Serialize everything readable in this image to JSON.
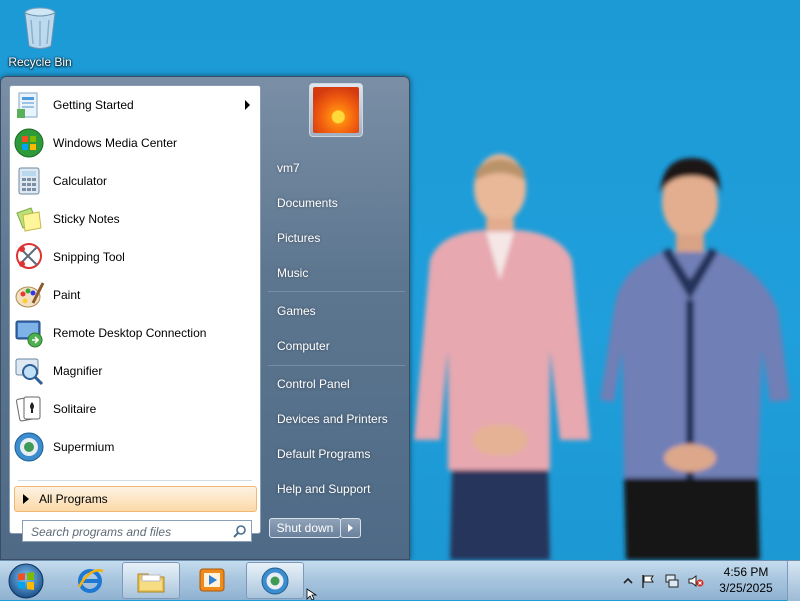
{
  "desktop": {
    "icons": [
      {
        "label": "Recycle Bin",
        "icon": "recycle-bin-icon"
      }
    ]
  },
  "start_menu": {
    "programs": [
      {
        "label": "Getting Started",
        "icon": "getting-started-icon",
        "has_submenu": true
      },
      {
        "label": "Windows Media Center",
        "icon": "media-center-icon"
      },
      {
        "label": "Calculator",
        "icon": "calculator-icon"
      },
      {
        "label": "Sticky Notes",
        "icon": "sticky-notes-icon"
      },
      {
        "label": "Snipping Tool",
        "icon": "snipping-tool-icon"
      },
      {
        "label": "Paint",
        "icon": "paint-icon"
      },
      {
        "label": "Remote Desktop Connection",
        "icon": "remote-desktop-icon"
      },
      {
        "label": "Magnifier",
        "icon": "magnifier-icon"
      },
      {
        "label": "Solitaire",
        "icon": "solitaire-icon"
      },
      {
        "label": "Supermium",
        "icon": "supermium-icon"
      }
    ],
    "all_programs": "All Programs",
    "search": {
      "placeholder": "Search programs and files"
    },
    "user": {
      "picture": "flower-user-picture"
    },
    "right_items": [
      {
        "label": "vm7"
      },
      {
        "label": "Documents"
      },
      {
        "label": "Pictures"
      },
      {
        "label": "Music"
      },
      {
        "label": "Games"
      },
      {
        "label": "Computer"
      },
      {
        "label": "Control Panel"
      },
      {
        "label": "Devices and Printers"
      },
      {
        "label": "Default Programs"
      },
      {
        "label": "Help and Support"
      }
    ],
    "shutdown": "Shut down"
  },
  "taskbar": {
    "pinned": [
      {
        "name": "internet-explorer-icon"
      },
      {
        "name": "file-explorer-icon"
      },
      {
        "name": "media-player-icon"
      },
      {
        "name": "supermium-icon"
      }
    ],
    "clock": {
      "time": "4:56 PM",
      "date": "3/25/2025"
    }
  },
  "colors": {
    "desktop": "#1e9bd7",
    "start_menu": "#5e7790",
    "all_programs_highlight": "#fbd9a8"
  }
}
